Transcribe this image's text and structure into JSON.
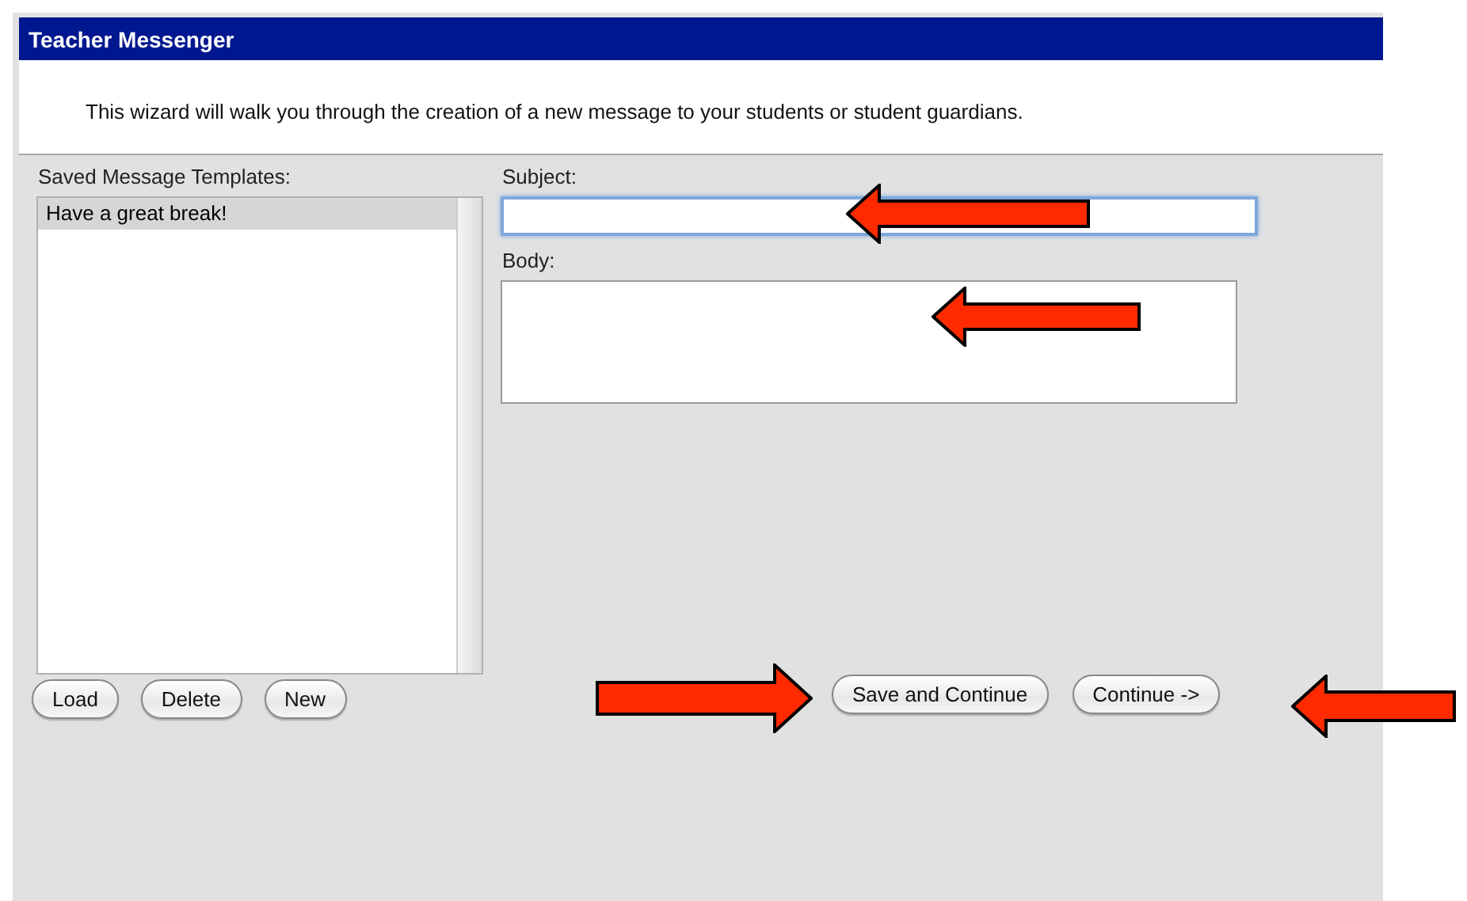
{
  "window": {
    "title": "Teacher Messenger"
  },
  "intro": "This wizard will walk you through the creation of a new message to your students or student guardians.",
  "templates": {
    "label": "Saved Message Templates:",
    "items": [
      {
        "text": "Have a great break!",
        "selected": true
      }
    ]
  },
  "template_buttons": [
    "Load",
    "Delete",
    "New"
  ],
  "subject": {
    "label": "Subject:",
    "focused": true
  },
  "body": {
    "label": "Body:"
  },
  "action_buttons": [
    "Save and Continue",
    "Continue ->"
  ],
  "annotation_arrows": [
    {
      "kind": "left"
    },
    {
      "kind": "left"
    },
    {
      "kind": "right"
    },
    {
      "kind": "left"
    }
  ]
}
